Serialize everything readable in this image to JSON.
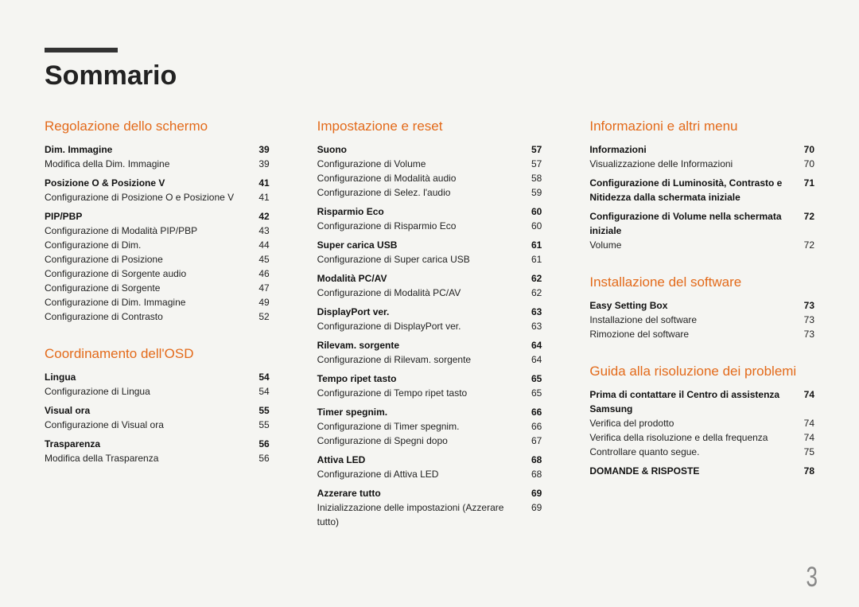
{
  "title": "Sommario",
  "page_number": "3",
  "columns": [
    {
      "sections": [
        {
          "heading": "Regolazione dello schermo",
          "groups": [
            {
              "sub": "Dim. Immagine",
              "subpage": "39",
              "items": [
                [
                  "Modifica della Dim. Immagine",
                  "39"
                ]
              ]
            },
            {
              "sub": "Posizione O & Posizione V",
              "subpage": "41",
              "items": [
                [
                  "Configurazione di Posizione O e Posizione V",
                  "41"
                ]
              ]
            },
            {
              "sub": "PIP/PBP",
              "subpage": "42",
              "items": [
                [
                  "Configurazione di Modalità PIP/PBP",
                  "43"
                ],
                [
                  "Configurazione di Dim.",
                  "44"
                ],
                [
                  "Configurazione di Posizione",
                  "45"
                ],
                [
                  "Configurazione di Sorgente audio",
                  "46"
                ],
                [
                  "Configurazione di Sorgente",
                  "47"
                ],
                [
                  "Configurazione di Dim. Immagine",
                  "49"
                ],
                [
                  "Configurazione di Contrasto",
                  "52"
                ]
              ]
            }
          ]
        },
        {
          "heading": "Coordinamento dell'OSD",
          "groups": [
            {
              "sub": "Lingua",
              "subpage": "54",
              "items": [
                [
                  "Configurazione di Lingua",
                  "54"
                ]
              ]
            },
            {
              "sub": "Visual ora",
              "subpage": "55",
              "items": [
                [
                  "Configurazione di Visual ora",
                  "55"
                ]
              ]
            },
            {
              "sub": "Trasparenza",
              "subpage": "56",
              "items": [
                [
                  "Modifica della Trasparenza",
                  "56"
                ]
              ]
            }
          ]
        }
      ]
    },
    {
      "sections": [
        {
          "heading": "Impostazione e reset",
          "groups": [
            {
              "sub": "Suono",
              "subpage": "57",
              "items": [
                [
                  "Configurazione di Volume",
                  "57"
                ],
                [
                  "Configurazione di Modalità audio",
                  "58"
                ],
                [
                  "Configurazione di Selez. l'audio",
                  "59"
                ]
              ]
            },
            {
              "sub": "Risparmio Eco",
              "subpage": "60",
              "items": [
                [
                  "Configurazione di Risparmio Eco",
                  "60"
                ]
              ]
            },
            {
              "sub": "Super carica USB",
              "subpage": "61",
              "items": [
                [
                  "Configurazione di Super carica USB",
                  "61"
                ]
              ]
            },
            {
              "sub": "Modalità PC/AV",
              "subpage": "62",
              "items": [
                [
                  "Configurazione di Modalità PC/AV",
                  "62"
                ]
              ]
            },
            {
              "sub": "DisplayPort ver.",
              "subpage": "63",
              "items": [
                [
                  "Configurazione di DisplayPort ver.",
                  "63"
                ]
              ]
            },
            {
              "sub": "Rilevam. sorgente",
              "subpage": "64",
              "items": [
                [
                  "Configurazione di Rilevam. sorgente",
                  "64"
                ]
              ]
            },
            {
              "sub": "Tempo ripet tasto",
              "subpage": "65",
              "items": [
                [
                  "Configurazione di Tempo ripet tasto",
                  "65"
                ]
              ]
            },
            {
              "sub": "Timer spegnim.",
              "subpage": "66",
              "items": [
                [
                  "Configurazione di Timer spegnim.",
                  "66"
                ],
                [
                  "Configurazione di Spegni dopo",
                  "67"
                ]
              ]
            },
            {
              "sub": "Attiva LED",
              "subpage": "68",
              "items": [
                [
                  "Configurazione di Attiva LED",
                  "68"
                ]
              ]
            },
            {
              "sub": "Azzerare tutto",
              "subpage": "69",
              "items": [
                [
                  "Inizializzazione delle impostazioni (Azzerare tutto)",
                  "69"
                ]
              ]
            }
          ]
        }
      ]
    },
    {
      "sections": [
        {
          "heading": "Informazioni e altri menu",
          "groups": [
            {
              "sub": "Informazioni",
              "subpage": "70",
              "items": [
                [
                  "Visualizzazione delle Informazioni",
                  "70"
                ]
              ]
            },
            {
              "sub": "Configurazione di Luminosità, Contrasto e Nitidezza dalla schermata iniziale",
              "subpage": "71",
              "items": []
            },
            {
              "sub": "Configurazione di Volume nella schermata iniziale",
              "subpage": "72",
              "items": [
                [
                  "Volume",
                  "72"
                ]
              ]
            }
          ]
        },
        {
          "heading": "Installazione del software",
          "groups": [
            {
              "sub": "Easy Setting Box",
              "subpage": "73",
              "items": [
                [
                  "Installazione del software",
                  "73"
                ],
                [
                  "Rimozione del software",
                  "73"
                ]
              ]
            }
          ]
        },
        {
          "heading": "Guida alla risoluzione dei problemi",
          "groups": [
            {
              "sub": "Prima di contattare il Centro di assistenza Samsung",
              "subpage": "74",
              "items": [
                [
                  "Verifica del prodotto",
                  "74"
                ],
                [
                  "Verifica della risoluzione e della frequenza",
                  "74"
                ],
                [
                  "Controllare quanto segue.",
                  "75"
                ]
              ]
            },
            {
              "sub": "DOMANDE & RISPOSTE",
              "subpage": "78",
              "items": []
            }
          ]
        }
      ]
    }
  ]
}
